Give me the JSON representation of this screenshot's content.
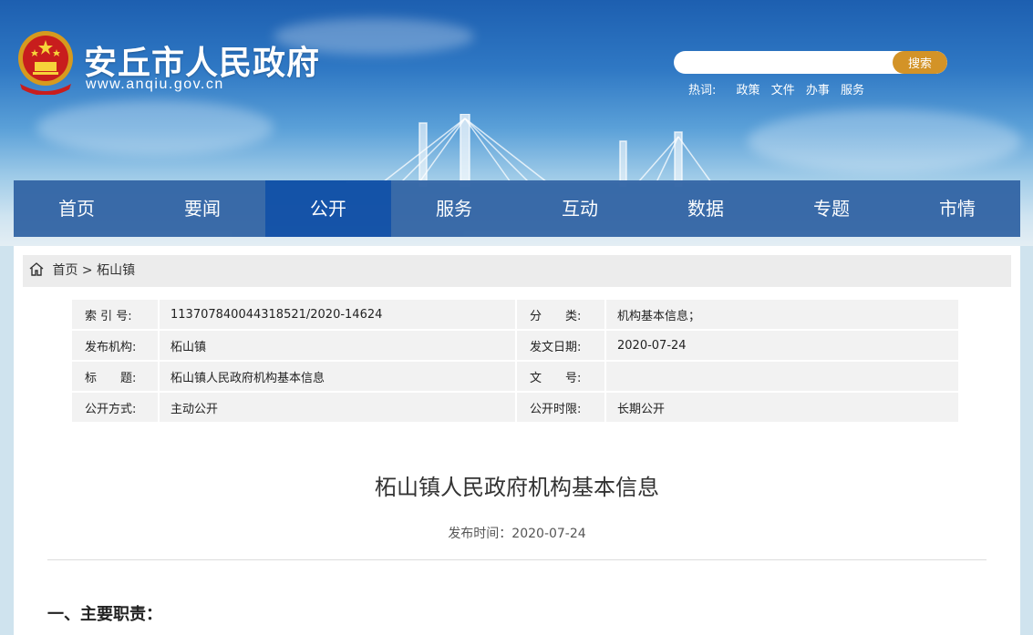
{
  "site": {
    "title": "安丘市人民政府",
    "url": "www.anqiu.gov.cn"
  },
  "search": {
    "placeholder": "",
    "button_label": "搜索"
  },
  "hotwords": {
    "label": "热词:",
    "items": [
      "政策",
      "文件",
      "办事",
      "服务"
    ]
  },
  "nav": {
    "items": [
      "首页",
      "要闻",
      "公开",
      "服务",
      "互动",
      "数据",
      "专题",
      "市情"
    ],
    "active": "公开"
  },
  "breadcrumb": {
    "home": "首页",
    "separator": ">",
    "current": "柘山镇"
  },
  "meta": {
    "rows": [
      {
        "k1": "索 引 号:",
        "v1": "113707840044318521/2020-14624",
        "k2": "分　　类:",
        "v2": "机构基本信息；"
      },
      {
        "k1": "发布机构:",
        "v1": "柘山镇",
        "k2": "发文日期:",
        "v2": "2020-07-24"
      },
      {
        "k1": "标　　题:",
        "v1": "柘山镇人民政府机构基本信息",
        "k2": "文　　号:",
        "v2": ""
      },
      {
        "k1": "公开方式:",
        "v1": "主动公开",
        "k2": "公开时限:",
        "v2": "长期公开"
      }
    ]
  },
  "document": {
    "title": "柘山镇人民政府机构基本信息",
    "date": "发布时间：2020-07-24",
    "section_heading": "一、主要职责："
  },
  "colors": {
    "nav_bg": "#3466a6",
    "nav_active": "#0e4ea6",
    "search_button": "#d39327"
  }
}
